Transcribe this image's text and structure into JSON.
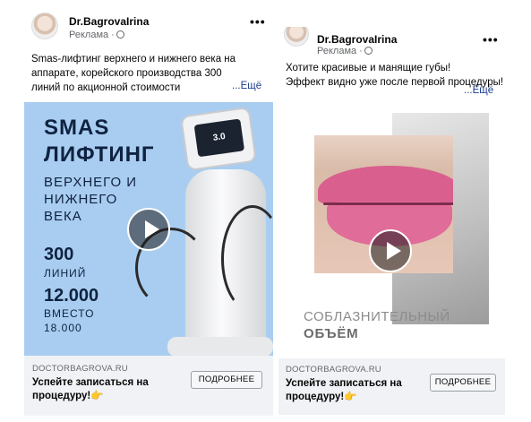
{
  "ads": [
    {
      "page_name": "Dr.BagrovaIrina",
      "sponsored_label": "Реклама ·",
      "text_lines": [
        "Smas-лифтинг верхнего и нижнего века на",
        "аппарате, корейского производства 300",
        "линий по акционной стоимости"
      ],
      "see_more": "...Ещё",
      "creative": {
        "title": [
          "SMAS",
          "ЛИФТИНГ"
        ],
        "subtitle": [
          "ВЕРХНЕГО И",
          "НИЖНЕГО",
          "ВЕКА"
        ],
        "lines_number": "300",
        "lines_word": "ЛИНИЙ",
        "price": "12.000",
        "instead_word": "ВМЕСТО",
        "old_price": "18.000",
        "device_screen": "3.0"
      },
      "domain": "DOCTORBAGROVA.RU",
      "cta_text": [
        "Успейте записаться на",
        "процедуру!👉"
      ],
      "button_label": "ПОДРОБНЕЕ"
    },
    {
      "page_name": "Dr.BagrovaIrina",
      "sponsored_label": "Реклама ·",
      "text_lines": [
        "Хотите красивые и манящие губы!",
        "Эффект видно уже после первой процедуры!"
      ],
      "see_more": "...Ещё",
      "creative": {
        "line1": "СОБЛАЗНИТЕЛЬНЫЙ",
        "line2": "ОБЪЁМ"
      },
      "domain": "DOCTORBAGROVA.RU",
      "cta_text": [
        "Успейте записаться на",
        "процедуру!👉"
      ],
      "button_label": "ПОДРОБНЕЕ"
    }
  ],
  "icons": {
    "more": "more-options-icon",
    "globe": "globe-icon",
    "play": "play-icon"
  }
}
